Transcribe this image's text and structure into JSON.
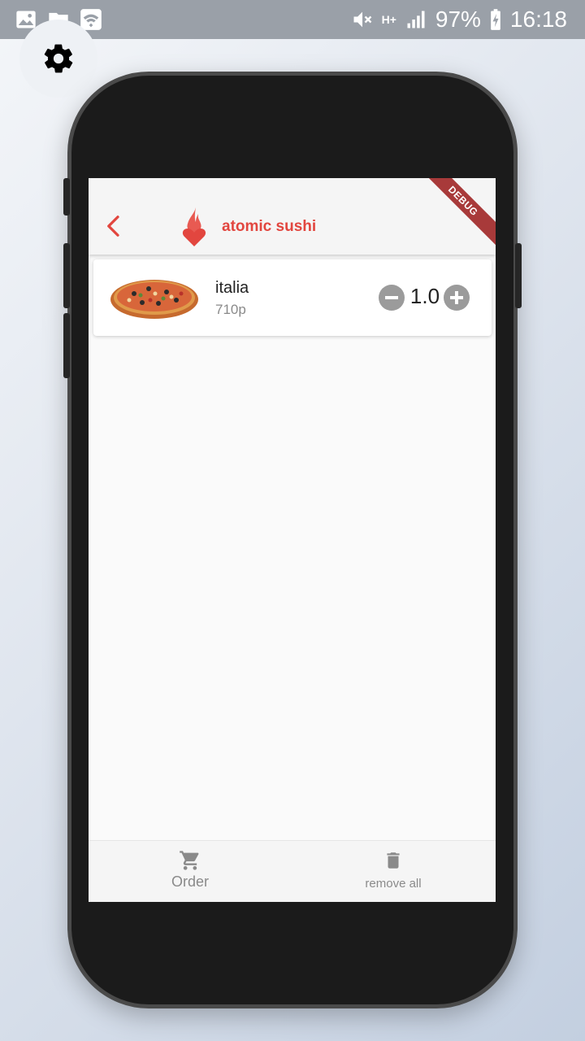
{
  "status_bar": {
    "battery": "97%",
    "time": "16:18",
    "network_label": "H+"
  },
  "app_bar": {
    "title": "atomic sushi",
    "debug_banner": "DEBUG"
  },
  "cart": {
    "items": [
      {
        "name": "italia",
        "price": "710p",
        "quantity": "1.0"
      }
    ]
  },
  "bottom_bar": {
    "order_label": "Order",
    "remove_label": "remove all"
  },
  "colors": {
    "brand": "#e2463f",
    "status_bar": "#9aa0a8",
    "muted_text": "#8a8a8a"
  },
  "icons": {
    "settings": "gear-icon",
    "back": "chevron-left-icon",
    "logo": "flame-heart-icon",
    "order": "shopping-cart-icon",
    "remove": "trash-icon"
  }
}
